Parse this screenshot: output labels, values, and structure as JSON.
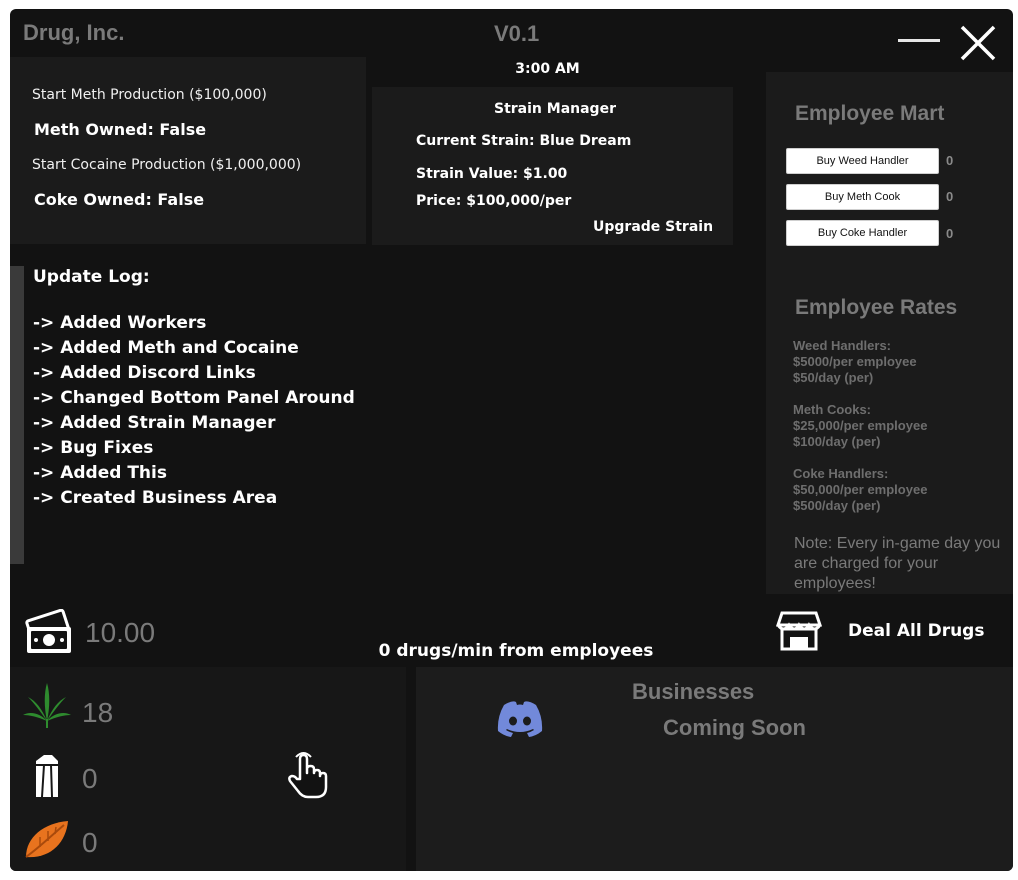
{
  "window": {
    "title": "Drug, Inc.",
    "version": "V0.1",
    "time": "3:00 AM"
  },
  "production": {
    "meth_link": "Start Meth Production ($100,000)",
    "meth_owned": "Meth Owned: False",
    "coke_link": "Start Cocaine Production ($1,000,000)",
    "coke_owned": "Coke Owned: False"
  },
  "strain": {
    "heading": "Strain Manager",
    "current": "Current Strain: Blue Dream",
    "value": "Strain Value: $1.00",
    "price": "Price: $100,000/per",
    "upgrade_label": "Upgrade Strain"
  },
  "mart": {
    "heading": "Employee Mart",
    "items": [
      {
        "label": "Buy Weed Handler",
        "count": "0"
      },
      {
        "label": "Buy Meth Cook",
        "count": "0"
      },
      {
        "label": "Buy Coke Handler",
        "count": "0"
      }
    ],
    "rates_heading": "Employee Rates",
    "rates": [
      {
        "title": "Weed Handlers:",
        "cost": "$5000/per employee",
        "daily": "$50/day (per)"
      },
      {
        "title": "Meth Cooks:",
        "cost": "$25,000/per employee",
        "daily": "$100/day (per)"
      },
      {
        "title": "Coke Handlers:",
        "cost": "$50,000/per employee",
        "daily": "$500/day (per)"
      }
    ],
    "note": "Note: Every in-game day you are charged for your employees!"
  },
  "update_log": {
    "heading": "Update Log:",
    "entries": [
      "-> Added Workers",
      "-> Added Meth and Cocaine",
      "-> Added Discord Links",
      "-> Changed Bottom Panel Around",
      "-> Added Strain Manager",
      "-> Bug Fixes",
      "-> Added This",
      "-> Created Business Area"
    ]
  },
  "stats": {
    "money": "10.00",
    "rate": "0 drugs/min from employees",
    "deal_label": "Deal All Drugs"
  },
  "inventory": {
    "weed": "18",
    "meth": "0",
    "coke": "0"
  },
  "businesses": {
    "title": "Businesses",
    "subtitle": "Coming Soon"
  },
  "colors": {
    "background": "#121212",
    "panel": "#1b1b1b",
    "muted_text": "#7a7a7a",
    "weed_green": "#2e8b2e",
    "leaf_orange": "#e8731e",
    "discord_blurple": "#7289da"
  },
  "icons": [
    "minimize-icon",
    "close-icon",
    "money-icon",
    "shop-icon",
    "weed-leaf-icon",
    "crystal-icon",
    "orange-leaf-icon",
    "hand-pointer-icon",
    "discord-icon"
  ]
}
